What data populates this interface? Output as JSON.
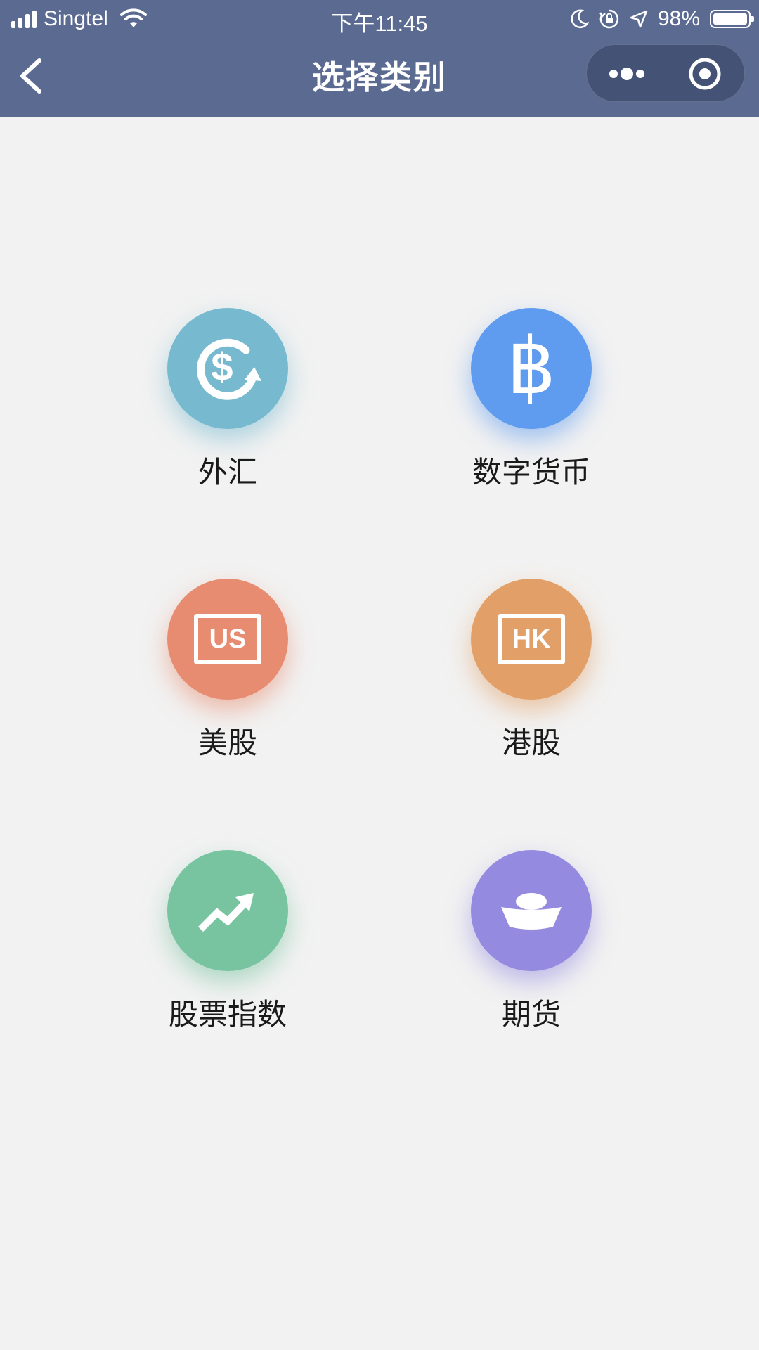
{
  "status_bar": {
    "carrier": "Singtel",
    "time": "下午11:45",
    "battery_percent": "98%",
    "battery_level": 0.98,
    "icons": [
      "signal-icon",
      "wifi-icon",
      "moon-icon",
      "orientation-lock-icon",
      "location-arrow-icon",
      "battery-icon"
    ]
  },
  "nav": {
    "title": "选择类别",
    "back_icon": "chevron-left-icon",
    "more_icon": "more-dots-icon",
    "close_icon": "target-close-icon"
  },
  "categories": [
    {
      "label": "外汇",
      "icon": "dollar-exchange-icon",
      "color": "#77b9cf"
    },
    {
      "label": "数字货币",
      "icon": "bitcoin-icon",
      "color": "#5f9bef",
      "glyph": "฿"
    },
    {
      "label": "美股",
      "icon": "us-stock-icon",
      "color": "#e78c70",
      "badge": "US"
    },
    {
      "label": "港股",
      "icon": "hk-stock-icon",
      "color": "#e2a068",
      "badge": "HK"
    },
    {
      "label": "股票指数",
      "icon": "trend-up-icon",
      "color": "#78c3a0"
    },
    {
      "label": "期货",
      "icon": "gold-ingot-icon",
      "color": "#948be0"
    }
  ],
  "colors": {
    "header_bg": "#5b6a91",
    "page_bg": "#f2f2f2",
    "label_text": "#1a1a1a"
  }
}
